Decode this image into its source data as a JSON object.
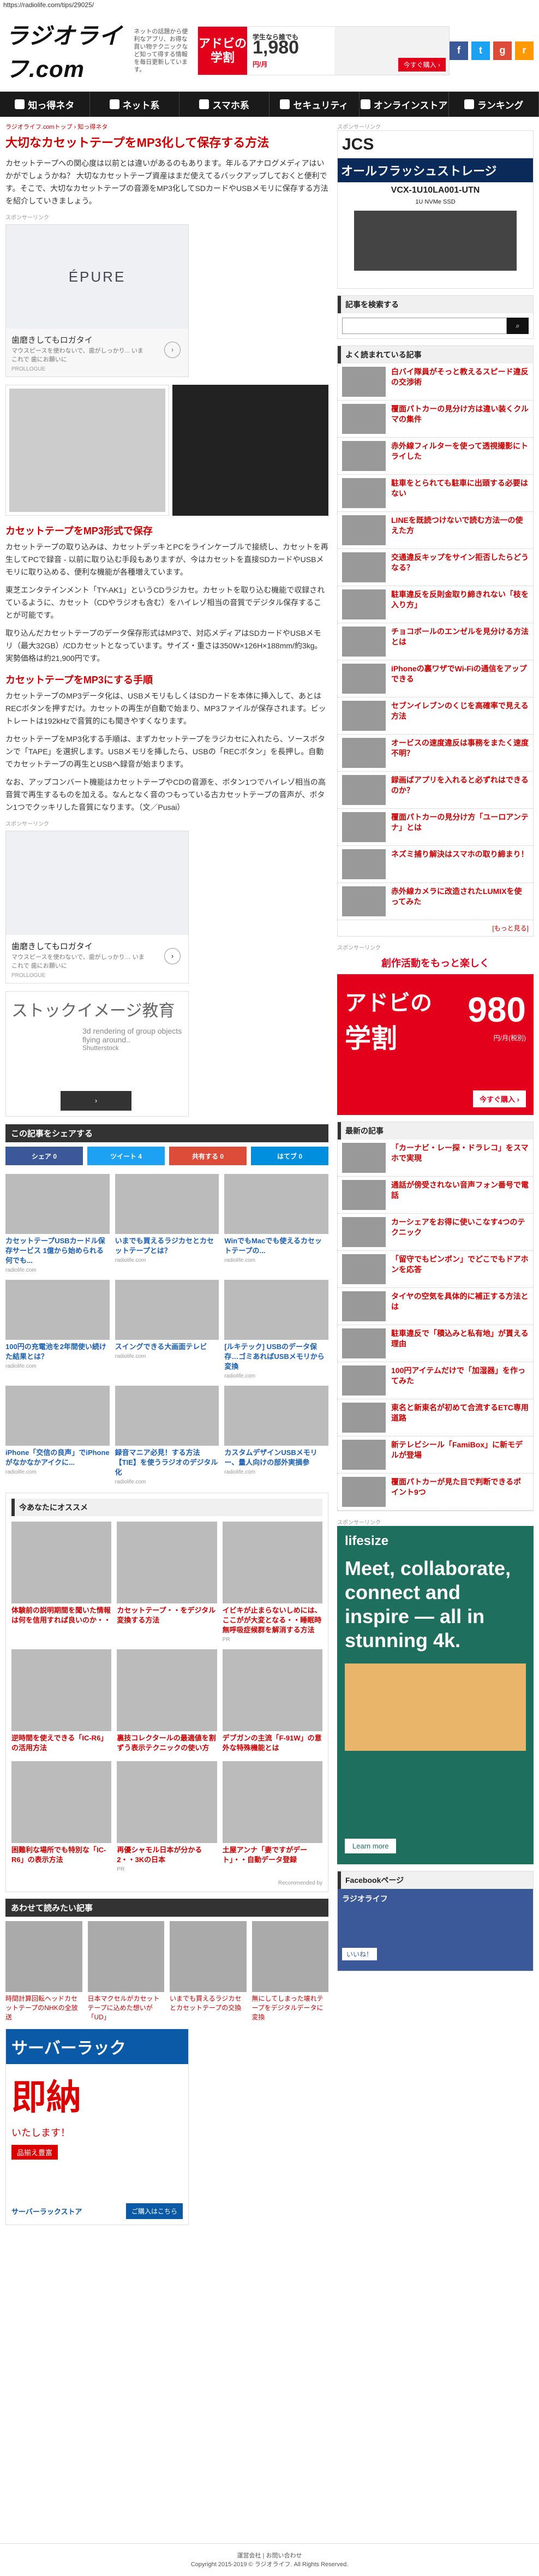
{
  "url": "https://radiolife.com/tips/29025/",
  "site": {
    "logo": "ラジオライフ.com",
    "tagline": "ネットの話題から便利なアプリ、お得な買い物テクニックなど知って得する情報を毎日更新しています。"
  },
  "header_ad": {
    "line1": "アドビの",
    "line2": "学割",
    "price_label": "学生なら誰でも",
    "price": "1,980",
    "price_unit": "円/月",
    "cta": "今すぐ購入 ›"
  },
  "social": [
    "f",
    "t",
    "g",
    "r"
  ],
  "nav": [
    "知っ得ネタ",
    "ネット系",
    "スマホ系",
    "セキュリティ",
    "オンラインストア",
    "ランキング"
  ],
  "article": {
    "breadcrumb": "ラジオライフ.comトップ › 知っ得ネタ",
    "title": "大切なカセットテープをMP3化して保存する方法",
    "p1": "カセットテープへの関心度は以前とは違いがあるのもあります。年ルるアナログメディアはいかがでしょうかね？ 大切なカセットテープ資産はまだ使えてるバックアップしておくと便利です。そこで、大切なカセットテープの音源をMP3化してSDカードやUSBメモリに保存する方法を紹介していきましょう。",
    "ad_label": "スポンサーリンク",
    "ad1": {
      "brand": "ÉPURE",
      "caption": "歯磨きしてもロガタイ",
      "sub": "マウスピースを使わないで、歯がしっかり... いまこれで 歯にお願いに",
      "src": "PROLLOGUE"
    },
    "h2a": "カセットテープをMP3形式で保存",
    "p2": "カセットテープの取り込みは、カセットデッキとPCをラインケーブルで接続し、カセットを再生してPCで録音 - 以前に取り込む手段もありますが、今はカセットを直接SDカードやUSBメモリに取り込める、便利な機能が各種増えています。",
    "p3": "東芝エンタテインメント「TY-AK1」というCDラジカセ。カセットを取り込む機能で収録されているように、カセット（CDやラジオも含む）をハイレゾ相当の音質でデジタル保存することが可能です。",
    "p4": "取り込んだカセットテープのデータ保存形式はMP3で、対応メディアはSDカードやUSBメモリ（最大32GB）/CDカセットとなっています。サイズ・重さは350W×126H×188mm/約3kg。実勢価格は約21,900円です。",
    "h2b": "カセットテープをMP3にする手順",
    "p5": "カセットテープのMP3データ化は、USBメモリもしくはSDカードを本体に挿入して、あとはRECボタンを押すだけ。カセットの再生が自動で始まり、MP3ファイルが保存されます。ビットレートは192kHzで音質的にも聞きやすくなります。",
    "p6": "カセットテープをMP3化する手順は、まずカセットテープをラジカセに入れたら、ソースボタンで「TAPE」を選択します。USBメモリを挿したら、USBの「RECボタン」を長押し。自動でカセットテープの再生とUSBへ録音が始まります。",
    "p7": "なお、アップコンバート機能はカセットテープやCDの音源を、ボタン1つでハイレゾ相当の高音質で再生するものを加える。なんとなく音のつもっている古カセットテープの音声が、ボタン1つでクッキリした音質になります。（文／Pusai）",
    "ad2": {
      "caption": "歯磨きしてもロガタイ",
      "sub": "マウスピースを使わないで、歯がしっかり… いまこれで 歯にお願いに",
      "src": "PROLLOGUE"
    },
    "ad3": {
      "text": "ストックイメージ教育",
      "sub": "3d rendering of group objects flying around..",
      "src": "Shutterstock"
    }
  },
  "share": {
    "title": "この記事をシェアする",
    "buttons": [
      "シェア 0",
      "ツイート 4",
      "共有する 0",
      "はてブ 0"
    ]
  },
  "related": [
    {
      "t": "カセットテープUSBカードル保存サービス 1億から始められる何でも...",
      "s": "radiolife.com"
    },
    {
      "t": "いまでも買えるラジカセとカセットテープとは？",
      "s": "radiolife.com"
    },
    {
      "t": "WinでもMacでも使えるカセットテープの...",
      "s": "radiolife.com"
    },
    {
      "t": "100円の充電池を2年間使い続けた結果とは？",
      "s": "radiolife.com"
    },
    {
      "t": "スイングできる大画面テレビ",
      "s": "radiolife.com"
    },
    {
      "t": "[ルキテック] USBのデータ保存…ゴミあればUSBメモリから変換",
      "s": "radiolife.com"
    },
    {
      "t": "iPhone「交信の良声」でiPhoneがなかなかアイクに...",
      "s": "radiolife.com"
    },
    {
      "t": "録音マニア必見！する方法 【TIE】を使うラジオのデジタル化",
      "s": "radiolife.com"
    },
    {
      "t": "カスタムデザインUSBメモリー、量人向けの部外実損参",
      "s": "radiolife.com"
    }
  ],
  "osusume": {
    "title": "今あなたにオススメ",
    "items": [
      {
        "t": "体験前の説明期間を聞いた情報は何を信用すれば良いのか・・",
        "s": ""
      },
      {
        "t": "カセットテープ・・をデジタル変換する方法",
        "s": ""
      },
      {
        "t": "イビキが止まらないしめには、ここがが大変となる・・睡眠時無呼吸症候群を解消する方法",
        "s": "PR"
      },
      {
        "t": "逆時間を使えできる「IC-R6」の活用方法",
        "s": ""
      },
      {
        "t": "裏技コレクタールの最適値を割ずう表示テクニックの使い方",
        "s": ""
      },
      {
        "t": "デブガンの主流「F-91W」の意外な特殊機能とは",
        "s": ""
      },
      {
        "t": "困難利な場所でも特別な「IC-R6」の表示方法",
        "s": ""
      },
      {
        "t": "再優シャモル日本が分かる2・・3Kの日本",
        "s": "PR"
      },
      {
        "t": "土屋アンナ「妻ですがデート」・・自動データ登録",
        "s": ""
      }
    ],
    "credit": "Recommended by"
  },
  "awasete": {
    "title": "あわせて読みたい記事",
    "items": [
      {
        "t": "時間計算回転ヘッドカセットテープのNHKの全放送"
      },
      {
        "t": "日本マクセルがカセットテープに込めた想いが「UD」"
      },
      {
        "t": "いまでも買えるラジカセとカセットテープの交換"
      },
      {
        "t": "無にしてしまった壊れテープをデジタルデータに変換"
      }
    ]
  },
  "bottom_ad": {
    "title": "サーバーラック",
    "big": "即納",
    "sub": "いたします！",
    "note": "品揃え豊富",
    "brand": "サーバーラックストア",
    "cta": "ご購入はこちら"
  },
  "sidebar": {
    "sponsor": "スポンサーリンク",
    "ad_jcs": {
      "brand": "JCS",
      "text": "オールフラッシュストレージ",
      "model": "VCX-1U10LA001-UTN",
      "sub": "1U NVMe SSD"
    },
    "search_title": "記事を検索する",
    "search_placeholder": "",
    "popular_title": "よく読まれている記事",
    "popular": [
      "白バイ隊員がそっと教えるスピード違反の交渉術",
      "覆面パトカーの見分け方は違い装くクルマの集件",
      "赤外線フィルターを使って透視撮影にトライした",
      "駐車をとられても駐車に出頭する必要はない",
      "LINEを既読つけないで読む方法一の使えた方",
      "交通違反キップをサイン拒否したらどうなる？",
      "駐車違反を反則金取り締きれない「枝を入り方」",
      "チョコボールのエンゼルを見分ける方法とは",
      "iPhoneの裏ワザでWi-Fiの通信をアップできる",
      "セブンイレブンのくじを高確率で見える方法",
      "オービスの速度違反は事務をまたく速度不明？",
      "録画ばアプリを入れると必ずれはできるのか？",
      "覆面パトカーの見分け方「ユーロアンテナ」とは",
      "ネズミ捕り解決はスマホの取り締まり！",
      "赤外線カメラに改造されたLUMIXを使ってみた"
    ],
    "more": "[もっと見る]",
    "ad_adobe": {
      "title": "創作活動をもっと楽しく",
      "l1": "アドビの",
      "l2": "学割",
      "price": "980",
      "unit": "円/月(税別)",
      "cta": "今すぐ購入 ›"
    },
    "new_title": "最新の記事",
    "newest": [
      "「カーナビ・レー探・ドラレコ」をスマホで実現",
      "通話が傍受されない音声フォン番号で電話",
      "カーシェアをお得に使いこなす4つのテクニック",
      "「留守でもピンポン」でどこでもドアホンを応答",
      "タイヤの空気を具体的に補正する方法とは",
      "駐車違反で「積込みと私有地」が貰える理由",
      "100円アイテムだけで「加湿器」を作ってみた",
      "東名と新東名が初めて合流するETC専用道路",
      "新テレビシール「FamiBox」に新モデルが登場",
      "覆面パトカーが見た目で判断できるポイント9つ"
    ],
    "ad_lifesize": {
      "brand": "lifesize",
      "headline": "Meet, collaborate, connect and inspire — all in stunning 4k.",
      "cta": "Learn more"
    },
    "fb_title": "Facebookページ",
    "fb_name": "ラジオライフ",
    "fb_likes": "いいね！"
  },
  "footer": {
    "links": "運営会社 | お問い合わせ",
    "copy": "Copyright 2015-2019 © ラジオライフ. All Rights Reserved."
  }
}
